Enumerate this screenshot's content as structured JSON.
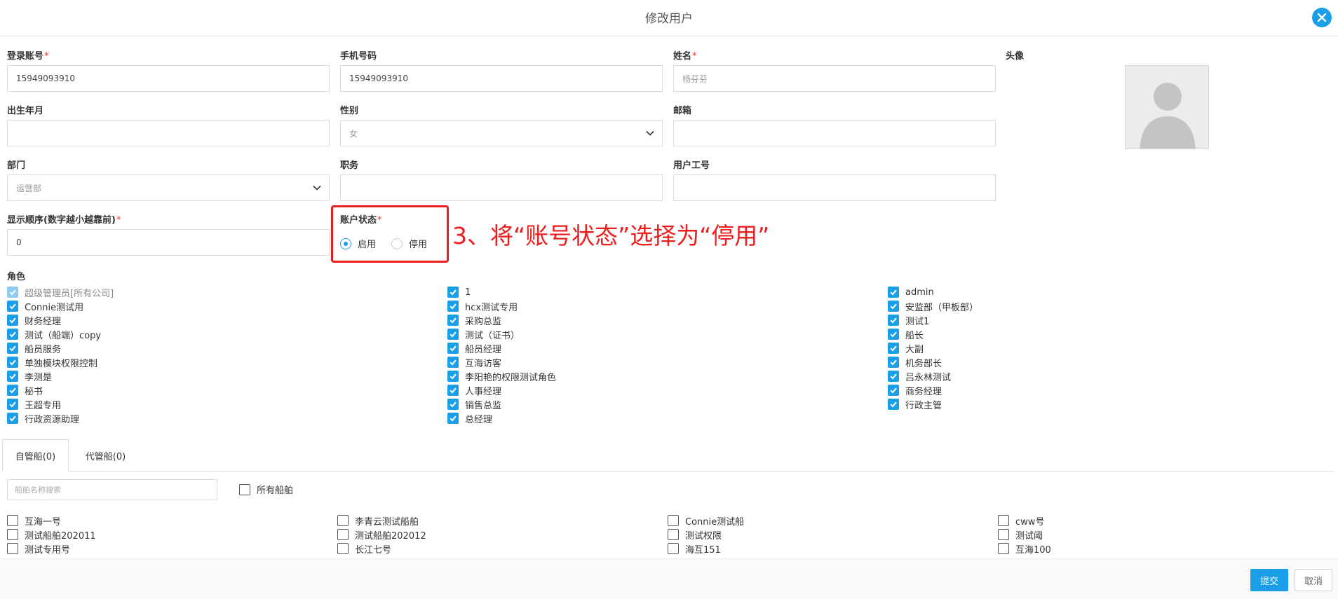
{
  "dialog": {
    "title": "修改用户"
  },
  "form": {
    "login_account": {
      "label": "登录账号",
      "value": "15949093910"
    },
    "phone": {
      "label": "手机号码",
      "value": "15949093910"
    },
    "name": {
      "label": "姓名",
      "value": "杨芬芬"
    },
    "avatar_label": "头像",
    "birth": {
      "label": "出生年月",
      "value": ""
    },
    "gender": {
      "label": "性别",
      "value": "女"
    },
    "email": {
      "label": "邮箱",
      "value": ""
    },
    "department": {
      "label": "部门",
      "value": "运营部"
    },
    "position": {
      "label": "职务",
      "value": ""
    },
    "employee_no": {
      "label": "用户工号",
      "value": ""
    },
    "order": {
      "label": "显示顺序(数字越小越靠前)",
      "value": "0"
    },
    "status": {
      "label": "账户状态",
      "options": [
        "启用",
        "停用"
      ],
      "selected": "启用"
    },
    "required_mark": "*"
  },
  "annotation": {
    "text": "3、将“账号状态”选择为“停用”",
    "color": "#ee1d1d"
  },
  "roles": {
    "label": "角色",
    "columns": [
      [
        {
          "text": "超级管理员[所有公司]",
          "checked": true,
          "disabled": true
        },
        {
          "text": "Connie测试用",
          "checked": true
        },
        {
          "text": "财务经理",
          "checked": true
        },
        {
          "text": "测试（船端）copy",
          "checked": true
        },
        {
          "text": "船员服务",
          "checked": true
        },
        {
          "text": "单独模块权限控制",
          "checked": true
        },
        {
          "text": "李测是",
          "checked": true
        },
        {
          "text": "秘书",
          "checked": true
        },
        {
          "text": "王超专用",
          "checked": true
        },
        {
          "text": "行政资源助理",
          "checked": true
        }
      ],
      [
        {
          "text": "1",
          "checked": true
        },
        {
          "text": "hcx测试专用",
          "checked": true
        },
        {
          "text": "采购总监",
          "checked": true
        },
        {
          "text": "测试（证书）",
          "checked": true
        },
        {
          "text": "船员经理",
          "checked": true
        },
        {
          "text": "互海访客",
          "checked": true
        },
        {
          "text": "李阳艳的权限测试角色",
          "checked": true
        },
        {
          "text": "人事经理",
          "checked": true
        },
        {
          "text": "销售总监",
          "checked": true
        },
        {
          "text": "总经理",
          "checked": true
        }
      ],
      [
        {
          "text": "admin",
          "checked": true
        },
        {
          "text": "安监部（甲板部）",
          "checked": true
        },
        {
          "text": "测试1",
          "checked": true
        },
        {
          "text": "船长",
          "checked": true
        },
        {
          "text": "大副",
          "checked": true
        },
        {
          "text": "机务部长",
          "checked": true
        },
        {
          "text": "吕永林测试",
          "checked": true
        },
        {
          "text": "商务经理",
          "checked": true
        },
        {
          "text": "行政主管",
          "checked": true
        }
      ]
    ]
  },
  "tabs": [
    {
      "label": "自管船(0)",
      "active": true
    },
    {
      "label": "代管船(0)",
      "active": false
    }
  ],
  "ships": {
    "search_placeholder": "船舶名称搜索",
    "all_label": "所有船舶",
    "columns": [
      [
        "互海一号",
        "测试船舶202011",
        "测试专用号"
      ],
      [
        "李青云测试船舶",
        "测试船舶202012",
        "长江七号"
      ],
      [
        "Connie测试船",
        "测试权限",
        "海互151"
      ],
      [
        "cww号",
        "测试阈",
        "互海100"
      ]
    ]
  },
  "footer": {
    "submit": "提交",
    "cancel": "取消"
  },
  "colors": {
    "accent": "#1a9ee8",
    "required": "#e53935"
  }
}
